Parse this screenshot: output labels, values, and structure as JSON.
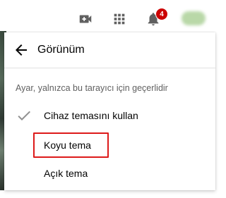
{
  "topbar": {
    "icons": [
      "video-camera-plus-icon",
      "apps-grid-icon",
      "notifications-bell-icon"
    ],
    "notification_count": "4",
    "badge_color": "#cc0000"
  },
  "menu": {
    "title": "Görünüm",
    "description": "Ayar, yalnızca bu tarayıcı için geçerlidir",
    "options": [
      {
        "label": "Cihaz temasını kullan",
        "selected": true
      },
      {
        "label": "Koyu tema",
        "selected": false,
        "highlighted": true
      },
      {
        "label": "Açık tema",
        "selected": false
      }
    ],
    "highlight_color": "#dd1a1a"
  }
}
